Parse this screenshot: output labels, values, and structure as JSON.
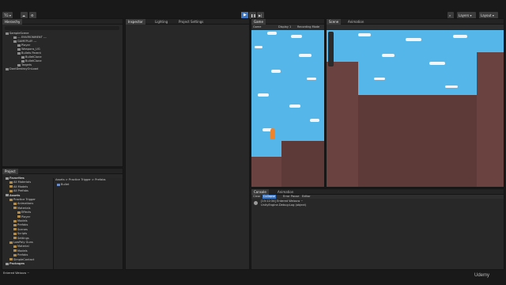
{
  "toolbar": {
    "account": "TG",
    "layers_label": "Layers",
    "layout_label": "Layout"
  },
  "hierarchy": {
    "tab": "Hierarchy",
    "search_placeholder": "All",
    "items": [
      {
        "label": "SampleScene",
        "indent": 0
      },
      {
        "label": "--- ENVIRONMENT ---",
        "indent": 2
      },
      {
        "label": "GAMEPLAY ---",
        "indent": 2
      },
      {
        "label": "Player",
        "indent": 3
      },
      {
        "label": "Weapons_UG",
        "indent": 3
      },
      {
        "label": "Bullets Parent",
        "indent": 3
      },
      {
        "label": "BulletClone",
        "indent": 4
      },
      {
        "label": "BulletClone",
        "indent": 4
      },
      {
        "label": "Targets",
        "indent": 3
      },
      {
        "label": "DontDestroyOnLoad",
        "indent": 0
      }
    ]
  },
  "inspector": {
    "tabs": [
      "Inspector",
      "Lighting",
      "Project Settings"
    ]
  },
  "game": {
    "tab": "Game",
    "display": "Game",
    "display2": "Display 1",
    "recording": "Recording Mode"
  },
  "scene": {
    "tabs": [
      "Scene",
      "Animation"
    ]
  },
  "project": {
    "tab": "Project",
    "tree": [
      {
        "label": "Favorites",
        "indent": 0,
        "bold": true
      },
      {
        "label": "All Materials",
        "indent": 1
      },
      {
        "label": "All Models",
        "indent": 1
      },
      {
        "label": "All Prefabs",
        "indent": 1
      },
      {
        "label": "Assets",
        "indent": 0,
        "bold": true
      },
      {
        "label": "Practice Trigger",
        "indent": 1
      },
      {
        "label": "Animations",
        "indent": 2
      },
      {
        "label": "Materials",
        "indent": 2
      },
      {
        "label": "Effects",
        "indent": 3
      },
      {
        "label": "Player",
        "indent": 3
      },
      {
        "label": "Models",
        "indent": 2
      },
      {
        "label": "Prefabs",
        "indent": 2
      },
      {
        "label": "Scenes",
        "indent": 2
      },
      {
        "label": "Scripts",
        "indent": 2
      },
      {
        "label": "Settings",
        "indent": 2
      },
      {
        "label": "LowPoly Guns",
        "indent": 1
      },
      {
        "label": "Material",
        "indent": 2
      },
      {
        "label": "Models",
        "indent": 2
      },
      {
        "label": "Prefabs",
        "indent": 2
      },
      {
        "label": "SimpleContact",
        "indent": 1
      },
      {
        "label": "Packages",
        "indent": 0,
        "bold": true
      }
    ],
    "breadcrumb": "Assets > Practice Trigger > Prefabs",
    "asset": "Bullet"
  },
  "console": {
    "tabs": [
      "Console",
      "Animation"
    ],
    "toolbar": [
      "Clear",
      "Collapse",
      "Error Pause",
      "Editor"
    ],
    "log_line1": "[15:12:34] Entered Weiouw ~",
    "log_line2": "UnityEngine.Debug:Log (object)"
  },
  "status_bar": {
    "text": "Entered Weiouw ~"
  },
  "watermark": "Udemy",
  "colors": {
    "sky": "#55b6ea",
    "dirt": "#6a4340",
    "accent_blue": "#3d77c4"
  }
}
